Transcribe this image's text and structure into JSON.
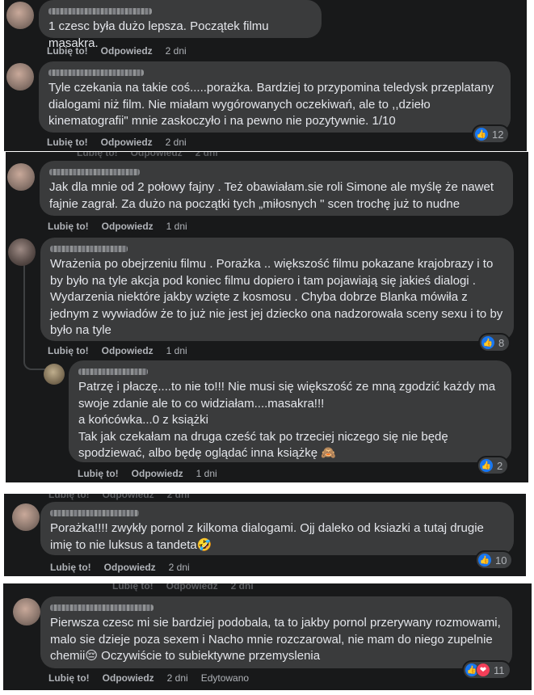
{
  "labels": {
    "like": "Lubię to!",
    "reply": "Odpowiedz",
    "edited": "Edytowano",
    "ghost_time": "2 dni"
  },
  "icons": {
    "like": "thumbs-up-icon",
    "love": "heart-icon"
  },
  "comments": [
    {
      "text": "1 czesc była dużo lepsza. Początek filmu masakra.",
      "time": "2 dni"
    },
    {
      "text": "Tyle czekania na takie coś.....porażka. Bardziej to przypomina teledysk przeplatany\ndialogami niż film. Nie miałam wygórowanych oczekiwań, ale to ,,dzieło\nkinematografii\" mnie zaskoczyło i na pewno nie pozytywnie. 1/10",
      "time": "2 dni",
      "reactions": "12"
    },
    {
      "text": "Jak dla mnie od 2 połowy fajny . Też obawiałam.sie roli Simone ale myślę że nawet\nfajnie zagrał. Za dużo na początki tych „miłosnych \" scen trochę już to nudne",
      "time": "1 dni"
    },
    {
      "text": "Wrażenia po obejrzeniu filmu . Porażka .. większość filmu pokazane krajobrazy i to\nby było na tyle akcja pod koniec filmu dopiero i tam pojawiają się jakieś dialogi .\nWydarzenia niektóre jakby wzięte z kosmosu . Chyba dobrze Blanka mówiła z\njednym z wywiadów że to już nie jest jej dziecko ona nadzorowała sceny sexu i to by\nbyło na tyle",
      "time": "1 dni",
      "reactions": "8"
    },
    {
      "text": "Patrzę i płaczę....to nie to!!! Nie musi się większość ze mną zgodzić każdy ma\nswoje zdanie ale to co widziałam....masakra!!!\na końcówka...0 z książki\nTak jak czekałam na druga cześć tak po trzeciej niczego się nie będę\nspodziewać, albo będę oglądać inna książkę 🙈",
      "time": "1 dni",
      "reactions": "2"
    },
    {
      "text": "Porażka!!!! zwykły pornol z kilkoma dialogami. Ojj daleko od ksiazki a tutaj drugie\nimię to nie luksus a tandeta🤣",
      "time": "2 dni",
      "reactions": "10"
    },
    {
      "text": "Pierwsza czesc mi sie bardziej podobala, ta to jakby pornol przerywany rozmowami,\nmalo sie dzieje poza sexem i Nacho mnie rozczarowal, nie mam do niego zupelnie\nchemii😔 Oczywiście to subiektywne przemyslenia",
      "time": "2 dni",
      "reactions": "11",
      "edited": true
    }
  ]
}
